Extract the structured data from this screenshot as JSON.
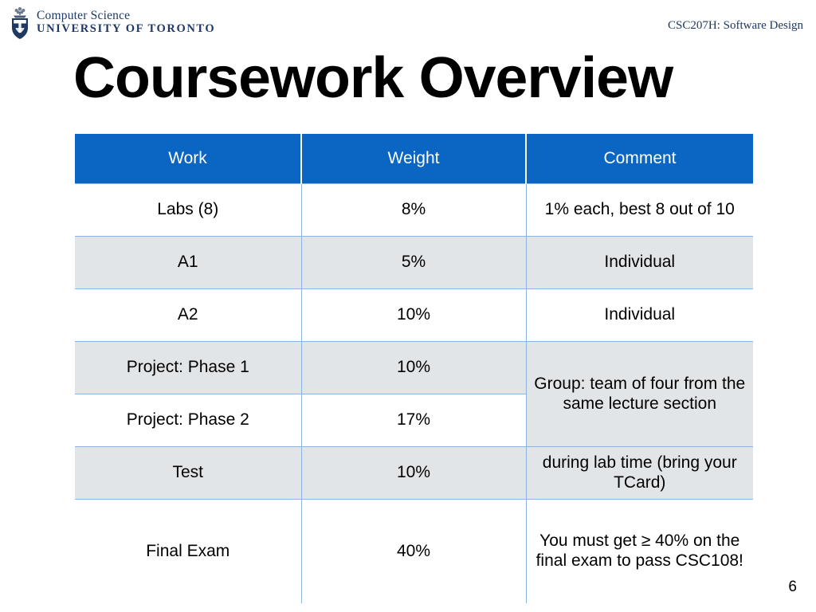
{
  "header": {
    "logo_line1": "Computer Science",
    "logo_line2": "UNIVERSITY OF TORONTO",
    "crest_icon": "uoft-crest-icon",
    "course": "CSC207H: Software Design"
  },
  "title": "Coursework Overview",
  "table": {
    "columns": [
      "Work",
      "Weight",
      "Comment"
    ],
    "rows": [
      {
        "work": "Labs (8)",
        "weight": "8%",
        "comment": "1% each, best 8 out of 10"
      },
      {
        "work": "A1",
        "weight": "5%",
        "comment": "Individual"
      },
      {
        "work": "A2",
        "weight": "10%",
        "comment": "Individual"
      },
      {
        "work": "Project: Phase 1",
        "weight": "10%",
        "comment": "Group: team of four from the same lecture section"
      },
      {
        "work": "Project: Phase 2",
        "weight": "17%",
        "comment": ""
      },
      {
        "work": "Test",
        "weight": "10%",
        "comment": "during lab time (bring your TCard)"
      },
      {
        "work": "Final Exam",
        "weight": "40%",
        "comment": "You must get ≥ 40% on the final exam to pass CSC108!"
      }
    ]
  },
  "slide_number": "6",
  "colors": {
    "header_blue": "#0b66c3",
    "row_gray": "#e2e5e8",
    "border_blue": "#8db4de",
    "brand_navy": "#1f3864"
  }
}
